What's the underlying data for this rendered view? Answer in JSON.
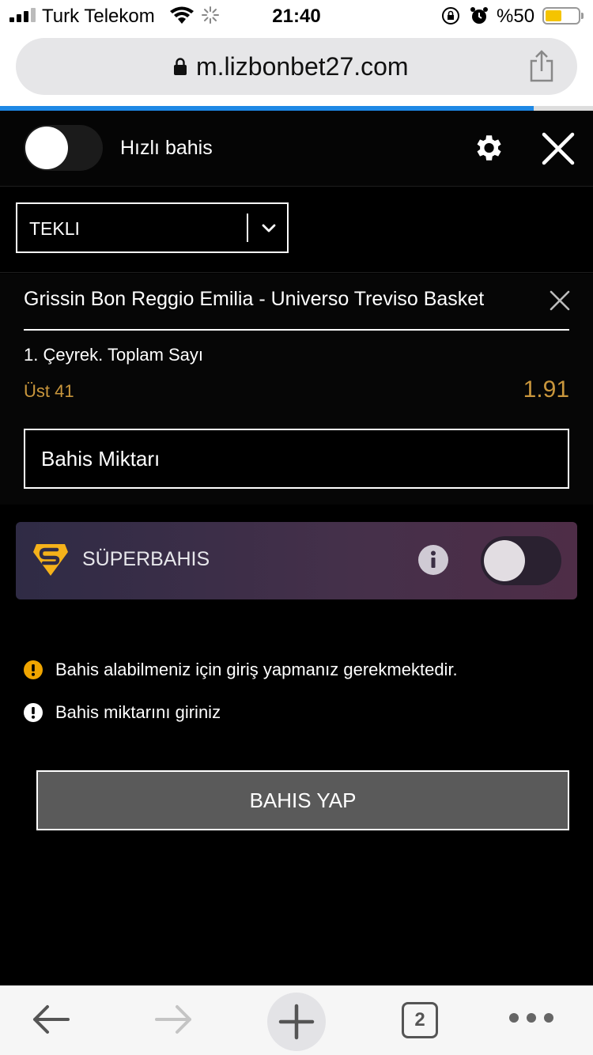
{
  "status_bar": {
    "carrier": "Turk Telekom",
    "time": "21:40",
    "battery_percent": "%50",
    "battery_level": 0.5
  },
  "browser": {
    "url": "m.lizbonbet27.com",
    "load_progress": 0.9,
    "open_tabs": "2"
  },
  "betslip": {
    "quick_bet_label": "Hızlı bahis",
    "bet_type": "TEKLI",
    "selection": {
      "match": "Grissin Bon Reggio Emilia - Universo Treviso Basket",
      "market": "1. Çeyrek. Toplam Sayı",
      "outcome": "Üst 41",
      "odds": "1.91"
    },
    "stake_placeholder": "Bahis Miktarı",
    "superbahis_label": "SÜPERBAHIS",
    "warnings": [
      {
        "icon": "warning-icon",
        "color": "#f0a500",
        "text": "Bahis alabilmeniz için giriş yapmanız gerekmektedir."
      },
      {
        "icon": "error-icon",
        "color": "#ffffff",
        "text": "Bahis miktarını giriniz"
      }
    ],
    "place_bet_label": "BAHIS YAP"
  },
  "colors": {
    "accent_gold": "#c9963c",
    "progress_blue": "#1e88e5",
    "superbahis_gradient": "#2f2b45"
  }
}
